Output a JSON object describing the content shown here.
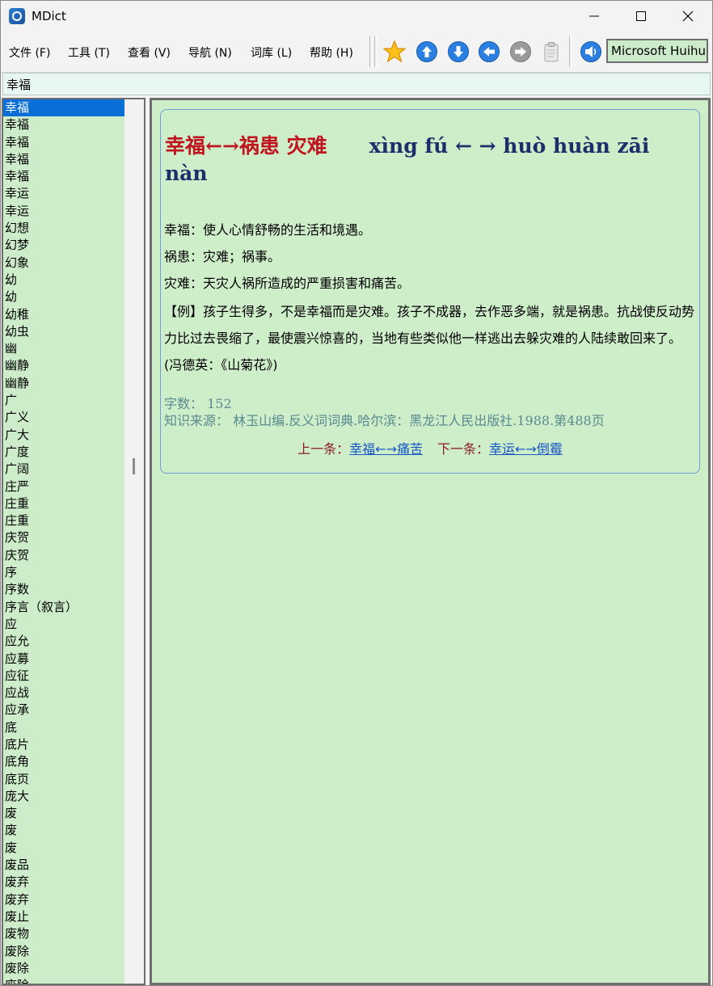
{
  "app": {
    "title": "MDict"
  },
  "menu": [
    {
      "label": "文件 (F)"
    },
    {
      "label": "工具 (T)"
    },
    {
      "label": "查看 (V)"
    },
    {
      "label": "导航 (N)"
    },
    {
      "label": "词库 (L)"
    },
    {
      "label": "帮助 (H)"
    }
  ],
  "toolbar": {
    "font_name": "Microsoft Huihui"
  },
  "search": {
    "value": "幸福"
  },
  "word_list": [
    "幸福",
    "幸福",
    "幸福",
    "幸福",
    "幸福",
    "幸运",
    "幸运",
    "幻想",
    "幻梦",
    "幻象",
    "幼",
    "幼",
    "幼稚",
    "幼虫",
    "幽",
    "幽静",
    "幽静",
    "广",
    "广义",
    "广大",
    "广度",
    "广阔",
    "庄严",
    "庄重",
    "庄重",
    "庆贺",
    "庆贺",
    "序",
    "序数",
    "序言（叙言）",
    "应",
    "应允",
    "应募",
    "应征",
    "应战",
    "应承",
    "底",
    "底片",
    "底角",
    "底页",
    "庞大",
    "废",
    "废",
    "废",
    "废品",
    "废弃",
    "废弃",
    "废止",
    "废物",
    "废除",
    "废除",
    "废除"
  ],
  "selected_index": 0,
  "entry": {
    "headword_cn": "幸福←→祸患 灾难",
    "headword_pinyin": "xìng fú ← → huò huàn zāi nàn",
    "definitions": [
      "幸福：使人心情舒畅的生活和境遇。",
      "祸患：灾难；祸事。",
      "灾难：天灾人祸所造成的严重损害和痛苦。"
    ],
    "example": "【例】孩子生得多，不是幸福而是灾难。孩子不成器，去作恶多端，就是祸患。抗战使反动势力比过去畏缩了，最使震兴惊喜的，当地有些类似他一样逃出去躲灾难的人陆续敢回来了。(冯德英：《山菊花》)",
    "char_count": "字数：  152",
    "source": "知识来源：  林玉山编.反义词词典.哈尔滨：黑龙江人民出版社.1988.第488页",
    "prev_label": "上一条：",
    "prev_link": "幸福←→痛苦",
    "next_label": "下一条：",
    "next_link": "幸运←→倒霉"
  },
  "colors": {
    "panel_bg": "#cdecca",
    "selection": "#0a6ed8",
    "headword_cn": "#c0141e",
    "headword_pinyin": "#1c2f6a",
    "link": "#1757c4",
    "meta": "#5a8a90"
  }
}
